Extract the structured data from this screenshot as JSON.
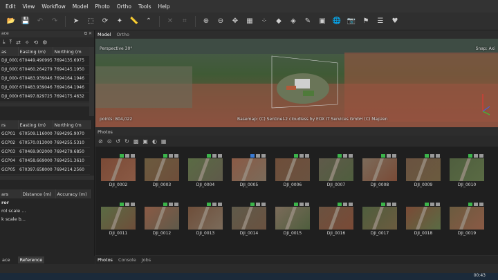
{
  "menu": [
    "Edit",
    "View",
    "Workflow",
    "Model",
    "Photo",
    "Ortho",
    "Tools",
    "Help"
  ],
  "panel_left": {
    "workspace_tab_partial": "ace",
    "cameras_table": {
      "headers": [
        "as",
        "Easting (m)",
        "Northing (m"
      ],
      "rows": [
        [
          "DJI_0002",
          "670449.490995",
          "7694135.6975"
        ],
        [
          "DJI_0003",
          "670460.264279",
          "7694145.1950"
        ],
        [
          "DJI_0004",
          "670483.939046",
          "7694164.1946"
        ],
        [
          "DJI_0005",
          "670483.939046",
          "7694164.1946"
        ],
        [
          "DJI_0006",
          "670497.829725",
          "7694175.4632"
        ]
      ]
    },
    "markers_table": {
      "headers": [
        "rs",
        "Easting (m)",
        "Northing (m"
      ],
      "rows": [
        [
          "GCP01",
          "670509.116000",
          "7694295.9070"
        ],
        [
          "GCP02",
          "670570.013000",
          "7694255.5310"
        ],
        [
          "GCP03",
          "670469.902000",
          "7694279.6850"
        ],
        [
          "GCP04",
          "670458.669000",
          "7694251.3610"
        ],
        [
          "GCP05",
          "670397.658000",
          "7694214.2560"
        ]
      ]
    },
    "scalebars_table": {
      "headers": [
        "ars",
        "Distance (m)",
        "Accuracy (m)"
      ]
    },
    "list_items": [
      "ror",
      "rol scale ...",
      "k scale b..."
    ],
    "bottom_tabs": [
      "ace",
      "Reference"
    ]
  },
  "model_tabs": [
    "Model",
    "Ortho"
  ],
  "viewport": {
    "perspective": "Perspective 30°",
    "snap": "Snap: Axi",
    "points": "points: 804,022",
    "basemap": "Basemap: (C) Sentinel-2 cloudless by EOX IT Services GmbH (C) Mapzen"
  },
  "photos_panel": {
    "title": "Photos",
    "thumbs_row1": [
      "DJI_0002",
      "DJI_0003",
      "DJI_0004",
      "DJI_0005",
      "DJI_0006",
      "DJI_0007",
      "DJI_0008",
      "DJI_0009",
      "DJI_0010"
    ],
    "thumbs_row2": [
      "DJI_0011",
      "DJI_0012",
      "DJI_0013",
      "DJI_0014",
      "DJI_0015",
      "DJI_0016",
      "DJI_0017",
      "DJI_0018",
      "DJI_0019"
    ]
  },
  "bottom_tabs": [
    "Photos",
    "Console",
    "Jobs"
  ],
  "taskbar": {
    "time": "00:43"
  },
  "colors": {
    "flag_green": "#3bb54a",
    "flag_blue": "#3a7bd5",
    "flag_gray": "#9a9a9a"
  }
}
